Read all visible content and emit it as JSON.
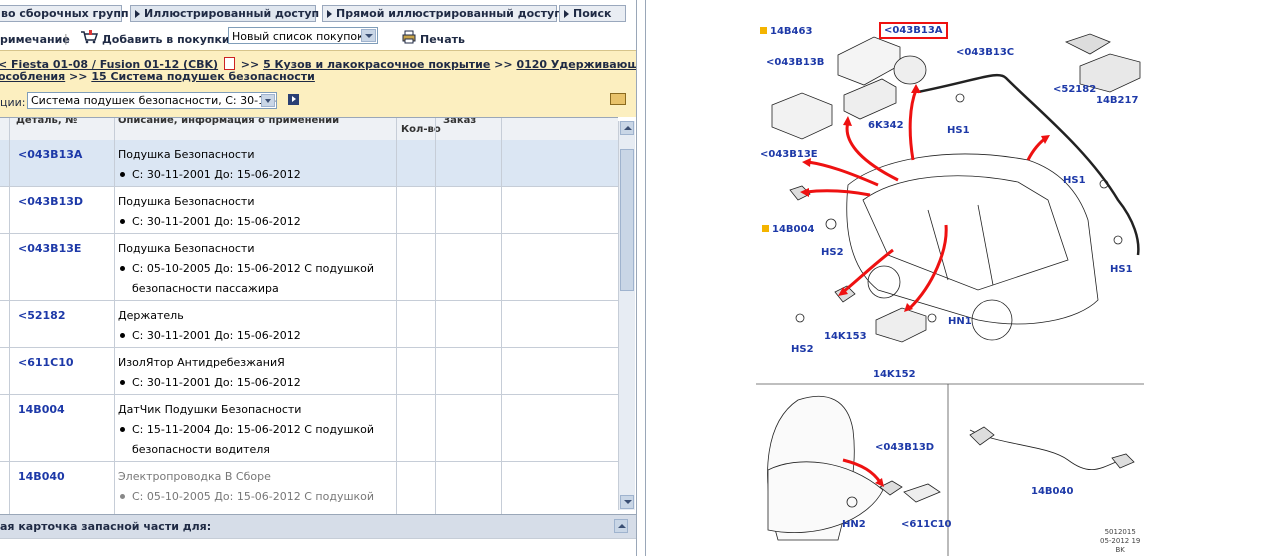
{
  "nav": {
    "tabs": [
      {
        "label": "во сборочных групп"
      },
      {
        "label": "Иллюстрированный доступ"
      },
      {
        "label": "Прямой иллюстрированный доступ"
      },
      {
        "label": "Поиск"
      }
    ]
  },
  "toolbar": {
    "note_label": "римечание",
    "add_to_cart_label": "Добавить в покупки",
    "shopping_list_value": "Новый список покупок",
    "print_label": "Печать"
  },
  "crumbs": {
    "line1_a": "< Fiesta 01-08 / Fusion 01-12 (CBK)",
    "line1_b": ">>",
    "line1_c": "5 Кузов и лакокрасочное покрытие",
    "line1_d": ">>",
    "line1_e": "0120 Удерживающие",
    "line2_a": "особления",
    "line2_b": ">>",
    "line2_c": "15 Система подушек безопасности",
    "section_label": "ции:",
    "section_value": "Система подушек безопасности, С: 30-11-20("
  },
  "table": {
    "headers": [
      "Деталь, №",
      "Описание, информация о применении",
      "Кол-во",
      "Заказ"
    ],
    "rows": [
      {
        "part": "<043B13A",
        "desc": "Подушка Безопасности",
        "lines": [
          "С: 30-11-2001 До: 15-06-2012"
        ],
        "selected": true,
        "grey": false
      },
      {
        "part": "<043B13D",
        "desc": "Подушка Безопасности",
        "lines": [
          "С: 30-11-2001 До: 15-06-2012"
        ],
        "selected": false,
        "grey": false
      },
      {
        "part": "<043B13E",
        "desc": "Подушка Безопасности",
        "lines": [
          "С: 05-10-2005 До: 15-06-2012 С подушкой",
          "безопасности пассажира"
        ],
        "selected": false,
        "grey": false
      },
      {
        "part": "<52182",
        "desc": "Держатель",
        "lines": [
          "С: 30-11-2001 До: 15-06-2012"
        ],
        "selected": false,
        "grey": false
      },
      {
        "part": "<611C10",
        "desc": "ИзолЯтор АнтидребезжаниЯ",
        "lines": [
          "С: 30-11-2001 До: 15-06-2012"
        ],
        "selected": false,
        "grey": false
      },
      {
        "part": "14B004",
        "desc": "ДатЧик Подушки Безопасности",
        "lines": [
          "С: 15-11-2004 До: 15-06-2012 С подушкой",
          "безопасности водителя"
        ],
        "selected": false,
        "grey": false
      },
      {
        "part": "14B040",
        "desc": "Электропроводка В Сборе",
        "lines": [
          "С: 05-10-2005 До: 15-06-2012 С подушкой"
        ],
        "selected": false,
        "grey": true
      }
    ]
  },
  "bottom": {
    "title": "ая карточка запасной части для:"
  },
  "diagram": {
    "labels": {
      "l14B463": "14B463",
      "l043B13A": "<043B13A",
      "l043B13C": "<043B13C",
      "l043B13B": "<043B13B",
      "l52182": "<52182",
      "l14B217": "14B217",
      "l6K342": "6K342",
      "lHS1a": "HS1",
      "l043B13E": "<043B13E",
      "lHS1b": "HS1",
      "l14B004": "14B004",
      "lHS2a": "HS2",
      "lHS1c": "HS1",
      "lHN1": "HN1",
      "l14K153": "14K153",
      "lHS2b": "HS2",
      "l14K152": "14K152",
      "l043B13D": "<043B13D",
      "l14B040": "14B040",
      "lHN2": "HN2",
      "l611C10": "<611C10"
    },
    "stamp": [
      "5012015",
      "05-2012 19",
      "BK"
    ],
    "colors": {
      "label": "#1d39a8",
      "arrow": "#e11",
      "highlight": "#e11",
      "marker": "#f4b400"
    }
  }
}
